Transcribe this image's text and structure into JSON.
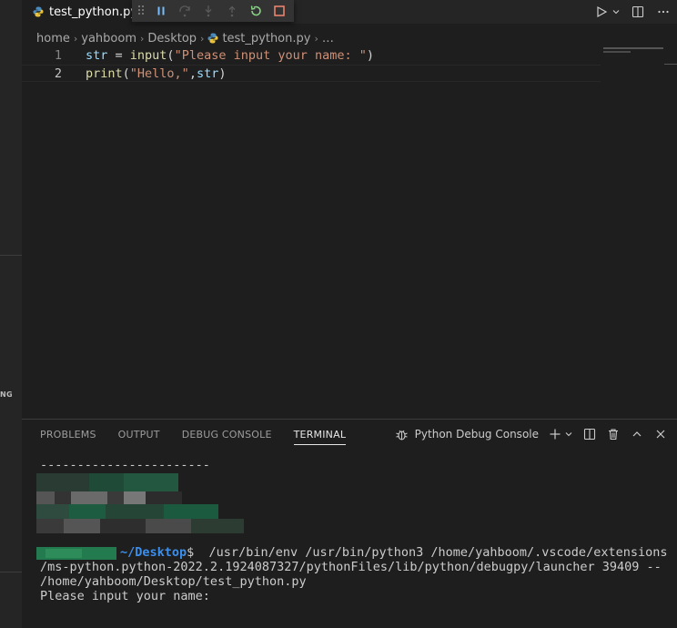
{
  "window": {
    "tab_label": "test_python.py",
    "left_fragment": "NG"
  },
  "breadcrumb": {
    "items": [
      "home",
      "yahboom",
      "Desktop",
      "test_python.py",
      "…"
    ]
  },
  "editor": {
    "lines": [
      {
        "num": "1"
      },
      {
        "num": "2"
      }
    ],
    "code": {
      "l1_var": "str",
      "l1_op": " = ",
      "l1_fn": "input",
      "l1_open": "(",
      "l1_str": "\"Please input your name: \"",
      "l1_close": ")",
      "l2_fn": "print",
      "l2_open": "(",
      "l2_str": "\"Hello,\"",
      "l2_comma": ",",
      "l2_var": "str",
      "l2_close": ")"
    }
  },
  "panel": {
    "tabs": [
      "PROBLEMS",
      "OUTPUT",
      "DEBUG CONSOLE",
      "TERMINAL"
    ],
    "active_tab": "TERMINAL",
    "terminal_name": "Python Debug Console"
  },
  "terminal": {
    "dashes": "-----------------------",
    "prompt_path": "~/Desktop",
    "prompt_symbol": "$",
    "command_l1": "  /usr/bin/env /usr/bin/python3 /home/yahboom/.vscode/extensions",
    "command_l2": "/ms-python.python-2022.2.1924087327/pythonFiles/lib/python/debugpy/launcher 39409 --",
    "command_l3": "/home/yahboom/Desktop/test_python.py",
    "output": "Please input your name:"
  },
  "colors": {
    "accent_blue": "#3b8eea",
    "debug_pause": "#75beff",
    "debug_restart": "#89d185",
    "debug_stop": "#f48771"
  }
}
